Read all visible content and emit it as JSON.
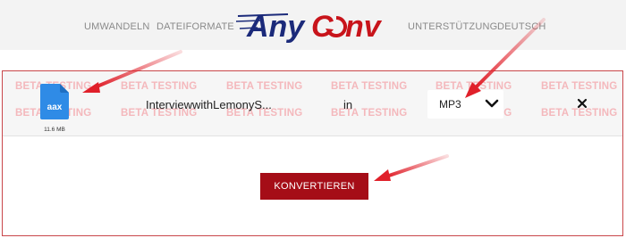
{
  "header": {
    "nav_left": [
      "UMWANDELN",
      "DATEIFORMATE"
    ],
    "nav_right": [
      "UNTERSTÜTZUNG",
      "DEUTSCH"
    ],
    "logo": {
      "part1": "Any",
      "part2": "C",
      "part3": "nv"
    }
  },
  "watermark_text": "BETA TESTING",
  "file": {
    "extension": "aax",
    "size": "11.6 MB",
    "name": "InterviewwithLemonyS...",
    "icon": "file-icon"
  },
  "in_label": "in",
  "format_select": {
    "value": "MP3",
    "icon": "chevron-down-icon"
  },
  "remove_icon": "close-icon",
  "convert_button": "KONVERTIEREN",
  "colors": {
    "brand_navy": "#1b2a7a",
    "brand_red": "#c8141b",
    "button_red": "#a50d17",
    "panel_border": "#c9464a",
    "file_icon_blue": "#2f8be6",
    "watermark": "#f4b8bc",
    "annotation_arrow": "#e0202a"
  }
}
